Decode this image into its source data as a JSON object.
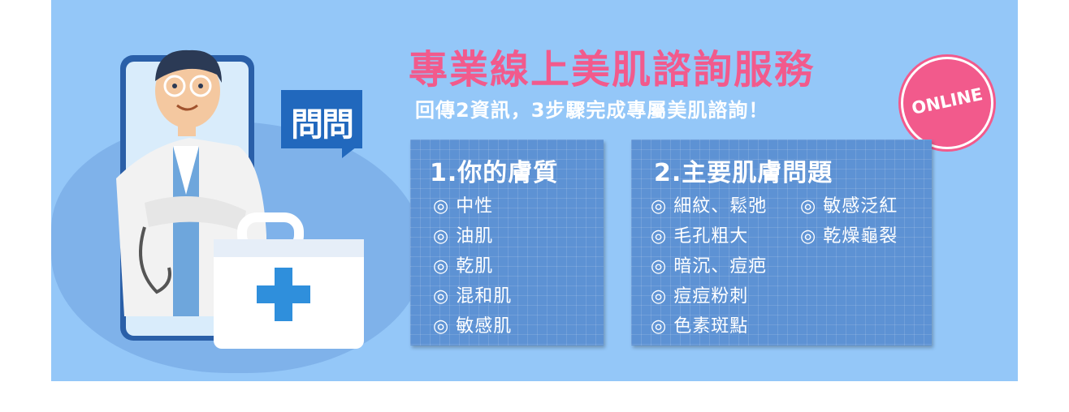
{
  "banner": {
    "title": "專業線上美肌諮詢服務",
    "subtitle": "回傳2資訊，3步驟完成專屬美肌諮詢！",
    "badge": "ONLINE",
    "bubble": "問問"
  },
  "card1": {
    "number": "1",
    "heading": ".你的膚質",
    "items": [
      "◎ 中性",
      "◎ 油肌",
      "◎ 乾肌",
      "◎ 混和肌",
      "◎ 敏感肌"
    ]
  },
  "card2": {
    "number": "2",
    "heading": ".主要肌膚問題",
    "col1": [
      "◎ 細紋、鬆弛",
      "◎ 毛孔粗大",
      "◎ 暗沉、痘疤",
      "◎ 痘痘粉刺",
      "◎ 色素斑點"
    ],
    "col2": [
      "◎ 敏感泛紅",
      "◎ 乾燥龜裂"
    ]
  },
  "colors": {
    "background": "#94c7f8",
    "title": "#f25a8c",
    "card": "#5d92d4",
    "bubble": "#2168bd"
  }
}
